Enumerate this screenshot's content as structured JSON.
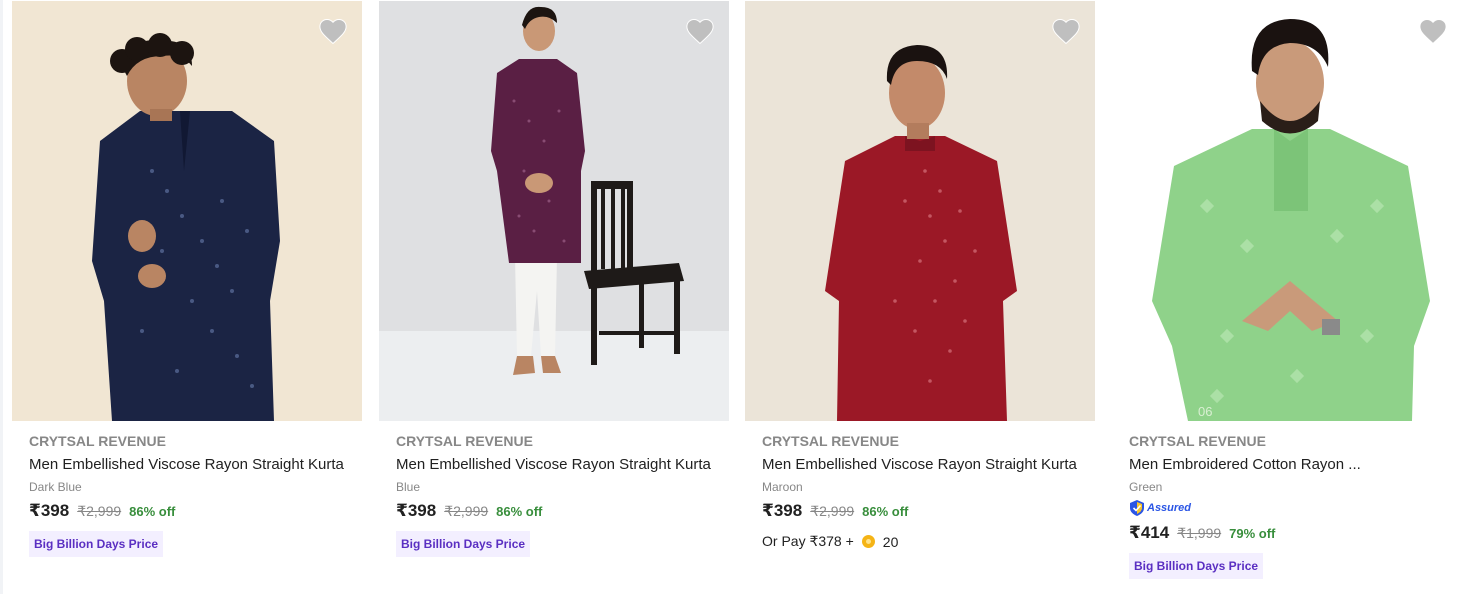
{
  "products": [
    {
      "brand": "CRYTSAL REVENUE",
      "title": "Men Embellished Viscose Rayon Straight Kurta",
      "variant": "Dark Blue",
      "price": "₹398",
      "mrp": "₹2,999",
      "discount": "86% off",
      "offer_tag": "Big Billion Days Price",
      "image": {
        "kurta_color": "#1b2444",
        "background": "#efe3cf"
      }
    },
    {
      "brand": "CRYTSAL REVENUE",
      "title": "Men Embellished Viscose Rayon Straight Kurta",
      "variant": "Blue",
      "price": "₹398",
      "mrp": "₹2,999",
      "discount": "86% off",
      "offer_tag": "Big Billion Days Price",
      "image": {
        "kurta_color": "#5a1f44",
        "background": "#dfe0e2"
      }
    },
    {
      "brand": "CRYTSAL REVENUE",
      "title": "Men Embellished Viscose Rayon Straight Kurta",
      "variant": "Maroon",
      "price": "₹398",
      "mrp": "₹2,999",
      "discount": "86% off",
      "or_pay": {
        "prefix": "Or Pay ₹378 +",
        "coins": "20"
      },
      "image": {
        "kurta_color": "#9b1826",
        "background": "#ebe4d8"
      }
    },
    {
      "brand": "CRYTSAL REVENUE",
      "title": "Men Embroidered Cotton Rayon ...",
      "variant": "Green",
      "assured_label": "Assured",
      "price": "₹414",
      "mrp": "₹1,999",
      "discount": "79% off",
      "offer_tag": "Big Billion Days Price",
      "image": {
        "kurta_color": "#8fd28a",
        "background": "#ffffff",
        "watermark": "06"
      }
    }
  ],
  "icons": {
    "wishlist": "heart-icon",
    "assured": "assured-badge-icon",
    "coin": "supercoin-icon"
  },
  "colors": {
    "discount_green": "#388e3c",
    "offer_purple": "#5a2fc2",
    "offer_bg": "#f3efff",
    "heart_grey": "#bfbfbf"
  }
}
